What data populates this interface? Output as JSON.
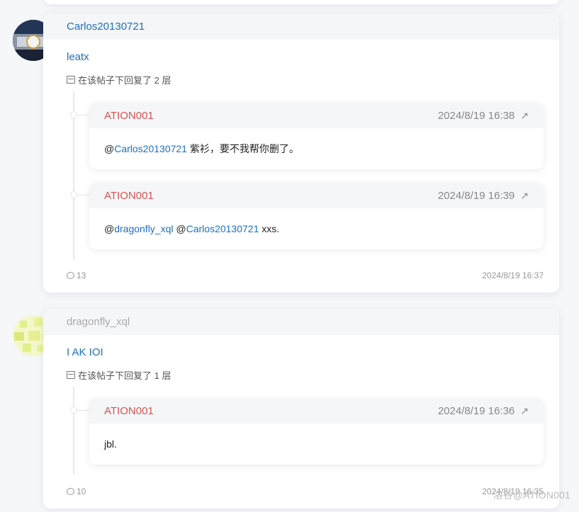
{
  "posts": [
    {
      "author": "Carlos20130721",
      "author_color": "#1e6fc0",
      "title": "leatx",
      "reply_info": "在该帖子下回复了 2 层",
      "replies": [
        {
          "author": "ATION001",
          "time": "2024/8/19 16:38",
          "body": [
            {
              "text": "@",
              "mention": false
            },
            {
              "text": "Carlos20130721",
              "mention": true
            },
            {
              "text": " 紫衫，要不我帮你删了。",
              "mention": false
            }
          ]
        },
        {
          "author": "ATION001",
          "time": "2024/8/19 16:39",
          "body": [
            {
              "text": "@",
              "mention": false
            },
            {
              "text": "dragonfly_xql",
              "mention": true
            },
            {
              "text": " @",
              "mention": false
            },
            {
              "text": "Carlos20130721",
              "mention": true
            },
            {
              "text": " xxs.",
              "mention": false
            }
          ]
        }
      ],
      "comment_count": "13",
      "posted_time": "2024/8/19 16:37"
    },
    {
      "author": "dragonfly_xql",
      "author_color": "#aaaaaa",
      "title": "I AK IOI",
      "reply_info": "在该帖子下回复了 1 层",
      "replies": [
        {
          "author": "ATION001",
          "time": "2024/8/19 16:36",
          "body": [
            {
              "text": "jbl.",
              "mention": false
            }
          ]
        }
      ],
      "comment_count": "10",
      "posted_time": "2024/8/19 16:35"
    }
  ],
  "icons": {
    "reply_info_icon": "archive-box-icon",
    "open_icon": "arrow-up-right-icon",
    "comment_icon": "chat-bubble-icon"
  },
  "watermark": "洛谷@ATION001"
}
